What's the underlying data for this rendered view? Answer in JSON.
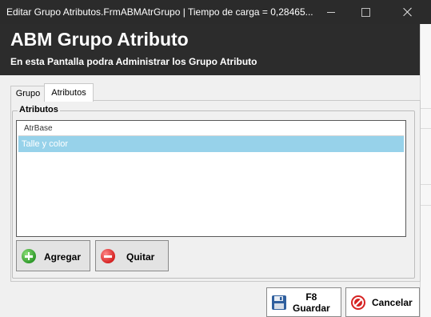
{
  "window": {
    "title": "Editar Grupo Atributos.FrmABMAtrGrupo | Tiempo de carga = 0,28465..."
  },
  "header": {
    "title": "ABM Grupo Atributo",
    "subtitle": "En esta Pantalla podra Administrar los Grupo Atributo"
  },
  "tabs": [
    {
      "label": "Grupo",
      "active": false
    },
    {
      "label": "Atributos",
      "active": true
    }
  ],
  "attributes_group": {
    "label": "Atributos",
    "grid": {
      "columns": [
        "AtrBase"
      ],
      "rows": [
        {
          "AtrBase": "Talle y color",
          "selected": true
        }
      ]
    },
    "buttons": {
      "add_label": "Agregar",
      "remove_label": "Quitar"
    }
  },
  "footer": {
    "save_shortcut": "F8",
    "save_label": "Guardar",
    "cancel_label": "Cancelar"
  },
  "colors": {
    "header_bg": "#2c2c2c",
    "titlebar_bg": "#2b2b2b",
    "selected_row": "#97d2ea",
    "window_bg": "#f0f0f0"
  },
  "icons": [
    "minimize-icon",
    "maximize-icon",
    "close-icon",
    "add-icon",
    "remove-icon",
    "save-icon",
    "cancel-icon"
  ]
}
